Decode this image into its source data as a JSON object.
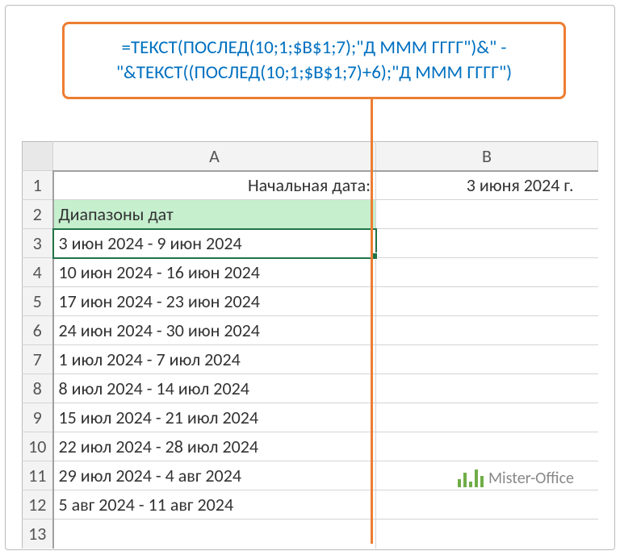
{
  "formula": {
    "line1": "=ТЕКСТ(ПОСЛЕД(10;1;$B$1;7);\"Д МММ ГГГГ\")&\" -",
    "line2": "\"&ТЕКСТ((ПОСЛЕД(10;1;$B$1;7)+6);\"Д МММ ГГГГ\")"
  },
  "columns": {
    "A": "A",
    "B": "B"
  },
  "rows": [
    "1",
    "2",
    "3",
    "4",
    "5",
    "6",
    "7",
    "8",
    "9",
    "10",
    "11",
    "12",
    "13"
  ],
  "cells": {
    "A1": "Начальная дата:",
    "B1": "3 июня 2024 г.",
    "A2": "Диапазоны дат",
    "A3": "3 июн 2024 - 9 июн 2024",
    "A4": "10 июн 2024 - 16 июн 2024",
    "A5": "17 июн 2024 - 23 июн 2024",
    "A6": "24 июн 2024 - 30 июн 2024",
    "A7": "1 июл 2024 - 7 июл 2024",
    "A8": "8 июл 2024 - 14 июл 2024",
    "A9": "15 июл 2024 - 21 июл 2024",
    "A10": "22 июл 2024 - 28 июл 2024",
    "A11": "29 июл 2024 - 4 авг 2024",
    "A12": "5 авг 2024 - 11 авг 2024"
  },
  "logo": "Mister-Office"
}
